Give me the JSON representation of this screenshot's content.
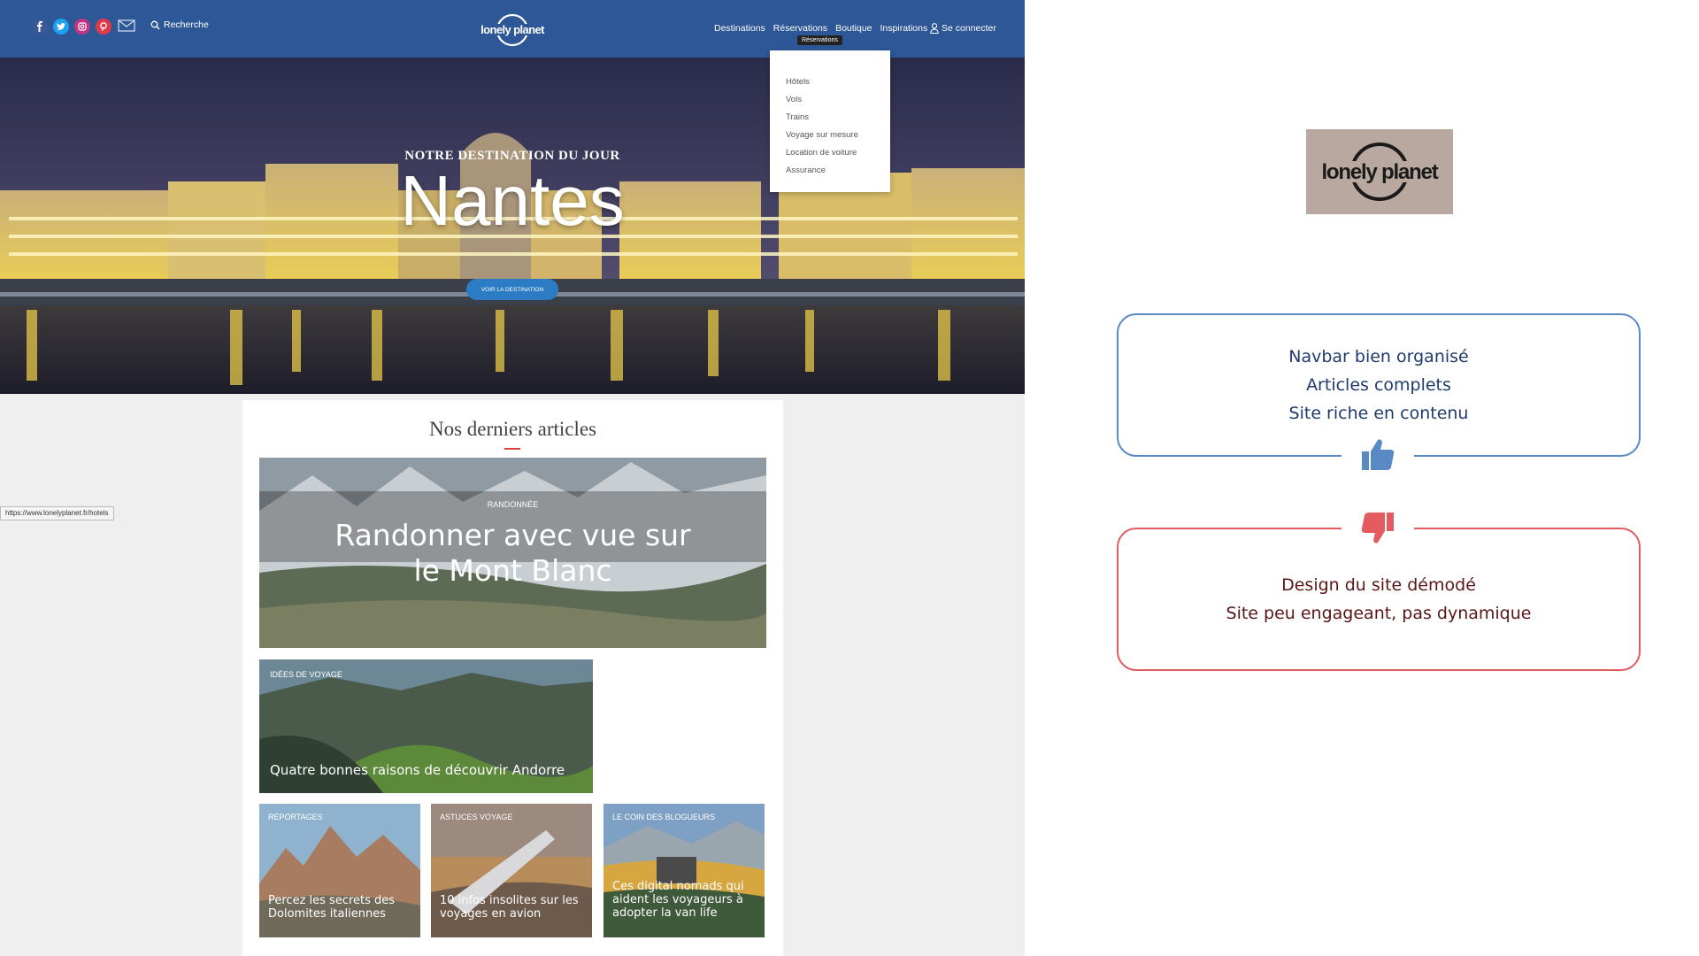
{
  "site": {
    "social_icons": [
      "facebook-icon",
      "twitter-icon",
      "instagram-icon",
      "pinterest-icon",
      "mail-icon"
    ],
    "search_label": "Recherche",
    "logo_text": "lonely planet",
    "menu": [
      "Destinations",
      "Réservations",
      "Boutique",
      "Inspirations"
    ],
    "login_label": "Se connecter",
    "tooltip": "Réservations",
    "dropdown": [
      "Hôtels",
      "Vols",
      "Trains",
      "Voyage sur mesure",
      "Location de voiture",
      "Assurance"
    ],
    "hero": {
      "kicker": "NOTRE DESTINATION DU JOUR",
      "title": "Nantes",
      "button": "VOIR LA DESTINATION"
    },
    "articles": {
      "heading": "Nos derniers articles",
      "feature": {
        "tag": "RANDONNÉE",
        "title_line1": "Randonner avec vue sur",
        "title_line2": "le Mont Blanc"
      },
      "second": {
        "tag": "IDÉES DE VOYAGE",
        "title": "Quatre bonnes raisons de découvrir Andorre"
      },
      "small": [
        {
          "tag": "REPORTAGES",
          "line1": "Percez les secrets des",
          "line2": "Dolomites italiennes"
        },
        {
          "tag": "ASTUCES VOYAGE",
          "line1": "10 infos insolites sur les",
          "line2": "voyages en avion"
        },
        {
          "tag": "LE COIN DES BLOGUEURS",
          "line0": "Ces digital nomads qui",
          "line1": "aident les voyageurs à",
          "line2": "adopter la van life"
        }
      ]
    },
    "status_url": "https://www.lonelyplanet.fr/hotels"
  },
  "evaluation": {
    "logo_text": "lonely planet",
    "pros": [
      "Navbar bien organisé",
      "Articles complets",
      "Site riche en contenu"
    ],
    "cons": [
      "Design du site démodé",
      "Site peu engageant, pas dynamique"
    ],
    "colors": {
      "pros": "#5a8ac4",
      "cons": "#e35b5e",
      "nav": "#2d5796"
    }
  }
}
